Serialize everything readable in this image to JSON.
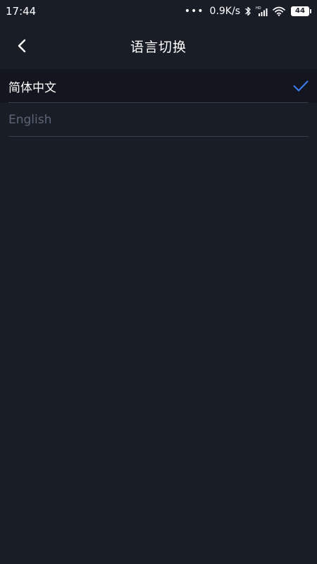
{
  "status_bar": {
    "time": "17:44",
    "dots": "•••",
    "net_speed": "0.9K/s",
    "battery": "44"
  },
  "header": {
    "title": "语言切换",
    "back_icon": "chevron-left-icon"
  },
  "languages": [
    {
      "label": "简体中文",
      "selected": true
    },
    {
      "label": "English",
      "selected": false
    }
  ],
  "colors": {
    "background": "#191d26",
    "selected_row": "#13161e",
    "accent": "#3d7ff5",
    "inactive_text": "#5c6475",
    "divider": "#3a3f4b"
  }
}
